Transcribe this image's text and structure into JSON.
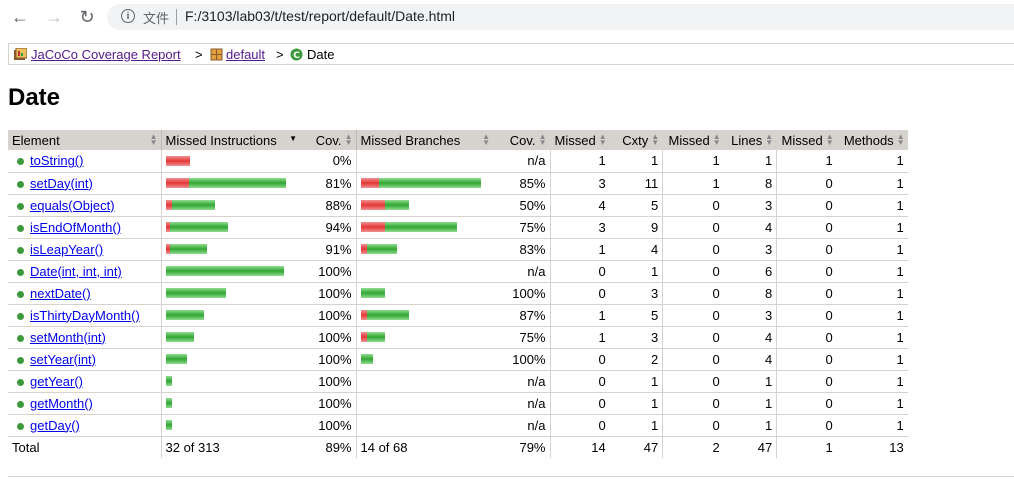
{
  "browser": {
    "protocol_label": "文件",
    "url": "F:/3103/lab03/t/test/report/default/Date.html"
  },
  "breadcrumb": {
    "report_link": "JaCoCo Coverage Report",
    "sep1": ">",
    "package_link": "default",
    "sep2": ">",
    "current": "Date"
  },
  "page_title": "Date",
  "table": {
    "headers": [
      "Element",
      "Missed Instructions",
      "Cov.",
      "Missed Branches",
      "Cov.",
      "Missed",
      "Cxty",
      "Missed",
      "Lines",
      "Missed",
      "Methods"
    ],
    "rows": [
      {
        "name": "toString()",
        "instr_red": 1.0,
        "instr_total": 13,
        "instr_cov": "0%",
        "br_red": 0,
        "br_total": 0,
        "br_cov": "n/a",
        "m_cxty": "1",
        "cxty": "1",
        "m_lines": "1",
        "lines": "1",
        "m_meth": "1",
        "meth": "1"
      },
      {
        "name": "setDay(int)",
        "instr_red": 0.19,
        "instr_total": 64,
        "instr_cov": "81%",
        "br_red": 0.15,
        "br_total": 20,
        "br_cov": "85%",
        "m_cxty": "3",
        "cxty": "11",
        "m_lines": "1",
        "lines": "8",
        "m_meth": "0",
        "meth": "1"
      },
      {
        "name": "equals(Object)",
        "instr_red": 0.12,
        "instr_total": 26,
        "instr_cov": "88%",
        "br_red": 0.5,
        "br_total": 8,
        "br_cov": "50%",
        "m_cxty": "4",
        "cxty": "5",
        "m_lines": "0",
        "lines": "3",
        "m_meth": "0",
        "meth": "1"
      },
      {
        "name": "isEndOfMonth()",
        "instr_red": 0.06,
        "instr_total": 33,
        "instr_cov": "94%",
        "br_red": 0.25,
        "br_total": 16,
        "br_cov": "75%",
        "m_cxty": "3",
        "cxty": "9",
        "m_lines": "0",
        "lines": "4",
        "m_meth": "0",
        "meth": "1"
      },
      {
        "name": "isLeapYear()",
        "instr_red": 0.09,
        "instr_total": 22,
        "instr_cov": "91%",
        "br_red": 0.17,
        "br_total": 6,
        "br_cov": "83%",
        "m_cxty": "1",
        "cxty": "4",
        "m_lines": "0",
        "lines": "3",
        "m_meth": "0",
        "meth": "1"
      },
      {
        "name": "Date(int, int, int)",
        "instr_red": 0,
        "instr_total": 63,
        "instr_cov": "100%",
        "br_red": 0,
        "br_total": 0,
        "br_cov": "n/a",
        "m_cxty": "0",
        "cxty": "1",
        "m_lines": "0",
        "lines": "6",
        "m_meth": "0",
        "meth": "1"
      },
      {
        "name": "nextDate()",
        "instr_red": 0,
        "instr_total": 32,
        "instr_cov": "100%",
        "br_red": 0,
        "br_total": 4,
        "br_cov": "100%",
        "m_cxty": "0",
        "cxty": "3",
        "m_lines": "0",
        "lines": "8",
        "m_meth": "0",
        "meth": "1"
      },
      {
        "name": "isThirtyDayMonth()",
        "instr_red": 0,
        "instr_total": 20,
        "instr_cov": "100%",
        "br_red": 0.13,
        "br_total": 8,
        "br_cov": "87%",
        "m_cxty": "1",
        "cxty": "5",
        "m_lines": "0",
        "lines": "3",
        "m_meth": "0",
        "meth": "1"
      },
      {
        "name": "setMonth(int)",
        "instr_red": 0,
        "instr_total": 15,
        "instr_cov": "100%",
        "br_red": 0.25,
        "br_total": 4,
        "br_cov": "75%",
        "m_cxty": "1",
        "cxty": "3",
        "m_lines": "0",
        "lines": "4",
        "m_meth": "0",
        "meth": "1"
      },
      {
        "name": "setYear(int)",
        "instr_red": 0,
        "instr_total": 11,
        "instr_cov": "100%",
        "br_red": 0,
        "br_total": 2,
        "br_cov": "100%",
        "m_cxty": "0",
        "cxty": "2",
        "m_lines": "0",
        "lines": "4",
        "m_meth": "0",
        "meth": "1"
      },
      {
        "name": "getYear()",
        "instr_red": 0,
        "instr_total": 3,
        "instr_cov": "100%",
        "br_red": 0,
        "br_total": 0,
        "br_cov": "n/a",
        "m_cxty": "0",
        "cxty": "1",
        "m_lines": "0",
        "lines": "1",
        "m_meth": "0",
        "meth": "1"
      },
      {
        "name": "getMonth()",
        "instr_red": 0,
        "instr_total": 3,
        "instr_cov": "100%",
        "br_red": 0,
        "br_total": 0,
        "br_cov": "n/a",
        "m_cxty": "0",
        "cxty": "1",
        "m_lines": "0",
        "lines": "1",
        "m_meth": "0",
        "meth": "1"
      },
      {
        "name": "getDay()",
        "instr_red": 0,
        "instr_total": 3,
        "instr_cov": "100%",
        "br_red": 0,
        "br_total": 0,
        "br_cov": "n/a",
        "m_cxty": "0",
        "cxty": "1",
        "m_lines": "0",
        "lines": "1",
        "m_meth": "0",
        "meth": "1"
      }
    ],
    "total": {
      "label": "Total",
      "instr": "32 of 313",
      "instr_cov": "89%",
      "br": "14 of 68",
      "br_cov": "79%",
      "m_cxty": "14",
      "cxty": "47",
      "m_lines": "2",
      "lines": "47",
      "m_meth": "1",
      "meth": "13"
    }
  }
}
